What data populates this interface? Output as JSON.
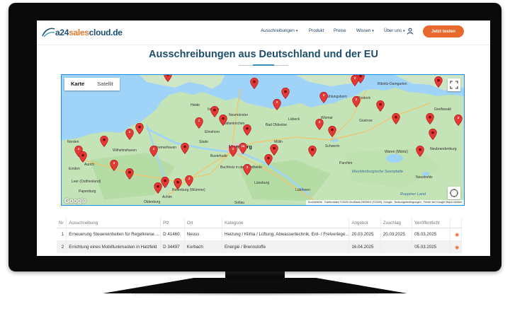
{
  "logo": {
    "part1": "a24",
    "part2": "sales",
    "part3": "cloud.de"
  },
  "nav": {
    "items": [
      {
        "label": "Ausschreibungen",
        "has_dropdown": true
      },
      {
        "label": "Produkt",
        "has_dropdown": false
      },
      {
        "label": "Preise",
        "has_dropdown": false
      },
      {
        "label": "Wissen",
        "has_dropdown": true
      },
      {
        "label": "Über uns",
        "has_dropdown": true
      }
    ],
    "user_icon": "user-icon",
    "cta_label": "Jetzt testen",
    "cta_color": "#e8692b"
  },
  "page": {
    "title": "Ausschreibungen aus Deutschland und der EU"
  },
  "map": {
    "type_buttons": [
      "Karte",
      "Satellit"
    ],
    "active_type": "Karte",
    "places": {
      "hamburg": "Hamburg",
      "schwerin": "Schwerin",
      "rostock": "Rostock",
      "bremerhaven": "Bremerhaven",
      "oldenburg": "Oldenburg",
      "aurich": "Aurich",
      "emden": "Emden",
      "wilhelmshaven": "Wilhelmshaven",
      "heide": "Heide",
      "neumuenster": "Neumünster",
      "luebeck": "Lübeck",
      "wismar": "Wismar",
      "neubrandenburg": "Neubrandenburg",
      "greifswald": "Greifswald",
      "lueneburg": "Lüneburg",
      "stade": "Stade",
      "itzehoe": "Itzehoe",
      "bad_oldesloe": "Bad Oldesloe",
      "kaltenkirchen": "Kaltenkirchen",
      "buxtehude": "Buxtehude",
      "waren": "Waren (Müritz)",
      "guestrow": "Güstrow",
      "parchim": "Parchim",
      "moelln": "Mölln",
      "neustrelitz": "Neustrelitz",
      "papenburg": "Papenburg",
      "leer": "Leer (Ostfriesland)",
      "norden": "Norden",
      "rotenburg": "Rotenburg (Wümme)",
      "achim": "Achim",
      "soltau": "Soltau",
      "mecklenburg_lake": "Mecklenburgische Seenplatte",
      "kuehlungsborn": "Kühlungsborn",
      "ribnitz": "Ribnitz-Damgarten",
      "buchholz": "Buchholz in der Nordheide",
      "ruppiner": "Ruppiner Land",
      "elmshorn": "Elmshorn",
      "luebtheen": "Lübtheen"
    },
    "pins": [
      {
        "label": ""
      },
      {
        "label": ""
      },
      {
        "label": "2"
      },
      {
        "label": ""
      },
      {
        "label": "3"
      },
      {
        "label": ""
      },
      {
        "label": "2"
      },
      {
        "label": ""
      },
      {
        "label": "14"
      },
      {
        "label": ""
      },
      {
        "label": "2"
      },
      {
        "label": ""
      },
      {
        "label": ""
      },
      {
        "label": "2"
      },
      {
        "label": ""
      },
      {
        "label": "2"
      },
      {
        "label": ""
      },
      {
        "label": "4"
      },
      {
        "label": ""
      },
      {
        "label": "2"
      },
      {
        "label": ""
      },
      {
        "label": ""
      },
      {
        "label": ""
      },
      {
        "label": ""
      },
      {
        "label": "2"
      },
      {
        "label": "2"
      },
      {
        "label": ""
      },
      {
        "label": "2"
      },
      {
        "label": ""
      },
      {
        "label": "3"
      },
      {
        "label": ""
      },
      {
        "label": "2"
      },
      {
        "label": ""
      },
      {
        "label": ""
      },
      {
        "label": ""
      },
      {
        "label": ""
      },
      {
        "label": ""
      },
      {
        "label": "2"
      },
      {
        "label": ""
      },
      {
        "label": ""
      }
    ],
    "attribution": [
      "Kurzbefehle",
      "Kartendaten ©2025 GeoBasis-DE/BKG (©2009), Google",
      "Nutzungsbedingungen",
      "Fehler bei Google Maps melden"
    ],
    "google_label": "Google",
    "pin_color": "#e53935"
  },
  "table": {
    "columns": [
      "Nr",
      "Ausschreibung",
      "Plz",
      "Ort",
      "Kategorie",
      "Angebot",
      "Zuschlag",
      "Veröffentlicht",
      ""
    ],
    "rows": [
      {
        "nr": "1",
        "title": "Erneuerung Steuereinheiten für Regelkreise ...",
        "plz": "D 41460",
        "ort": "Neuss",
        "kategorie": "Heizung / Klima / Lüftung, Abwassertechnik, Erd- / Freiverlege...",
        "angebot": "20.03.2025",
        "zuschlag": "20.03.2025",
        "veroeffentlicht": "05.03.2025",
        "icon": "eye-icon"
      },
      {
        "nr": "2",
        "title": "Errichtung eines Mobilfunkmasten in Hatzfeld",
        "plz": "D 34497",
        "ort": "Korbach",
        "kategorie": "Energie / Brennstoffe",
        "angebot": "16.04.2025",
        "zuschlag": "",
        "veroeffentlicht": "05.03.2025",
        "icon": "eye-icon"
      }
    ]
  }
}
